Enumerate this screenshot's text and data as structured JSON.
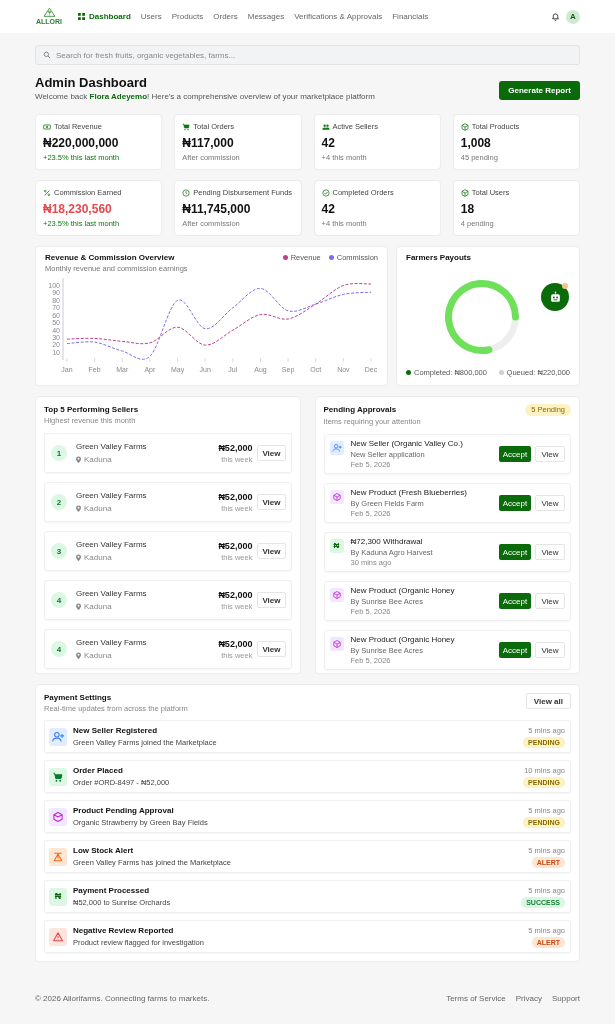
{
  "nav": {
    "logo_text": "ALLORI",
    "items": [
      {
        "label": "Dashboard",
        "selected": true,
        "has_icon": true
      },
      {
        "label": "Users",
        "selected": false,
        "has_icon": false
      },
      {
        "label": "Products",
        "selected": false,
        "has_icon": false
      },
      {
        "label": "Orders",
        "selected": false,
        "has_icon": false
      },
      {
        "label": "Messages",
        "selected": false,
        "has_icon": false
      },
      {
        "label": "Verifications & Approvals",
        "selected": false,
        "has_icon": false
      },
      {
        "label": "Financials",
        "selected": false,
        "has_icon": false
      }
    ],
    "avatar": "A"
  },
  "search": {
    "placeholder": "Search for fresh fruits, organic vegetables, farms..."
  },
  "header": {
    "title": "Admin Dashboard",
    "subtitle": "Welcome back **Flora Adeyemo**! Here's a comprehensive overview of your marketplace platform",
    "button": "Generate Report"
  },
  "stats": [
    {
      "kind": "cash",
      "label": "Total Revenue",
      "value": "₦220,000,000",
      "note": "+23.5% this last month",
      "trend_up": true,
      "color": "#111111"
    },
    {
      "kind": "cart",
      "label": "Total Orders",
      "value": "₦117,000",
      "note": "After commission",
      "trend_up": false,
      "color": "#111111"
    },
    {
      "kind": "users",
      "label": "Active Sellers",
      "value": "42",
      "note": "+4 this month",
      "trend_up": false,
      "color": "#111111"
    },
    {
      "kind": "cube",
      "label": "Total Products",
      "value": "1,008",
      "note": "45 pending",
      "trend_up": false,
      "color": "#111111"
    },
    {
      "kind": "percent",
      "label": "Commission Earned",
      "value": "₦18,230,560",
      "note": "+23.5% this last month",
      "trend_up": true,
      "color": "#e5484d"
    },
    {
      "kind": "clock",
      "label": "Pending Disbursement Funds",
      "value": "₦11,745,000",
      "note": "After commission",
      "trend_up": false,
      "color": "#111111"
    },
    {
      "kind": "check",
      "label": "Completed Orders",
      "value": "42",
      "note": "+4 this month",
      "trend_up": false,
      "color": "#111111"
    },
    {
      "kind": "cube",
      "label": "Total Users",
      "value": "18",
      "note": "4 pending",
      "trend_up": false,
      "color": "#111111"
    }
  ],
  "revenue_chart": {
    "subtitle": "Monthly revenue and commission earnings",
    "chart_data": {
      "type": "line",
      "title": "Revenue & Commission Overview",
      "categories": [
        "Jan",
        "Feb",
        "Mar",
        "Apr",
        "May",
        "Jun",
        "Jul",
        "Aug",
        "Sep",
        "Oct",
        "Nov",
        "Dec"
      ],
      "series": [
        {
          "name": "Revenue",
          "color": "#c0408f",
          "line_style": "dashed",
          "values": [
            28,
            29,
            25,
            23,
            44,
            20,
            40,
            61,
            55,
            75,
            100,
            102
          ]
        },
        {
          "name": "Commission",
          "color": "#7c6cf0",
          "line_style": "dashed",
          "values": [
            22,
            24,
            12,
            5,
            80,
            42,
            70,
            96,
            66,
            75,
            88,
            91
          ]
        }
      ],
      "ylim": [
        0,
        110
      ],
      "yticks": [
        10,
        20,
        30,
        40,
        50,
        60,
        70,
        80,
        90,
        100
      ]
    }
  },
  "payouts": {
    "title": "Farmers Payouts",
    "chart_data": {
      "type": "donut",
      "categories": [
        "Completed: ₦800,000",
        "Queued: ₦220,000"
      ],
      "values": [
        800000,
        220000
      ]
    },
    "legend": [
      {
        "color": "#0b6b0b"
      },
      {
        "color": "#cfcfcf"
      }
    ]
  },
  "top_sellers": {
    "title": "Top 5 Performing Sellers",
    "subtitle": "Highest revenue this month",
    "rows": [
      {
        "rank": "1",
        "name": "Green Valley Farms",
        "location": "Kaduna",
        "amount": "₦52,000",
        "period": "this week",
        "button": "View"
      },
      {
        "rank": "2",
        "name": "Green Valley Farms",
        "location": "Kaduna",
        "amount": "₦52,000",
        "period": "this week",
        "button": "View"
      },
      {
        "rank": "3",
        "name": "Green Valley Farms",
        "location": "Kaduna",
        "amount": "₦52,000",
        "period": "this week",
        "button": "View"
      },
      {
        "rank": "4",
        "name": "Green Valley Farms",
        "location": "Kaduna",
        "amount": "₦52,000",
        "period": "this week",
        "button": "View"
      },
      {
        "rank": "4",
        "name": "Green Valley Farms",
        "location": "Kaduna",
        "amount": "₦52,000",
        "period": "this week",
        "button": "View"
      }
    ]
  },
  "pending_approvals": {
    "title": "Pending Approvals",
    "badge": "5 Pending",
    "subtitle": "Items requiring your attention",
    "items": [
      {
        "kind": "seller",
        "title": "New Seller (Organic Valley Co.)",
        "by": "New Seller application",
        "date": "Feb 5, 2026",
        "accept": "Accept",
        "view": "View"
      },
      {
        "kind": "product",
        "title": "New Product (Fresh Blueberries)",
        "by": "By Green Fields Farm",
        "date": "Feb 5, 2026",
        "accept": "Accept",
        "view": "View"
      },
      {
        "kind": "withdrawal",
        "icon": "₦",
        "title": "₦72,300 Withdrawal",
        "by": "By Kaduna Agro Harvest",
        "date": "30 mins ago",
        "accept": "Accept",
        "view": "View"
      },
      {
        "kind": "product",
        "title": "New Product (Organic Honey",
        "by": "By Sunrise Bee Acres",
        "date": "Feb 5, 2026",
        "accept": "Accept",
        "view": "View"
      },
      {
        "kind": "product",
        "title": "New Product (Organic Honey",
        "by": "By Sunrise Bee Acres",
        "date": "Feb 5, 2026",
        "accept": "Accept",
        "view": "View"
      }
    ]
  },
  "payment_settings": {
    "title": "Payment Settings",
    "subtitle": "Real-time updates from across the platform",
    "button": "View all",
    "items": [
      {
        "kind": "seller",
        "title": "New Seller Registered",
        "description": "Green Valley Farms joined the Marketplace",
        "time": "5 mins ago",
        "status": {
          "label": "PENDING",
          "kind": "pending"
        }
      },
      {
        "kind": "order",
        "title": "Order Placed",
        "description": "Order #ORD-8497 - ₦52,000",
        "time": "10 mins ago",
        "status": {
          "label": "PENDING",
          "kind": "pending"
        }
      },
      {
        "kind": "product",
        "title": "Product Pending Approval",
        "description": "Organic Strawberry by Green Bay Fields",
        "time": "5 mins ago",
        "status": {
          "label": "PENDING",
          "kind": "pending"
        }
      },
      {
        "kind": "stock",
        "title": "Low Stock Alert",
        "description": "Green Valley Farms has joined the Marketplace",
        "time": "5 mins ago",
        "status": {
          "label": "ALERT",
          "kind": "alert"
        }
      },
      {
        "kind": "payment",
        "icon": "₦",
        "title": "Payment Processed",
        "description": "₦52,000 to Sunrise Orchards",
        "time": "5 mins ago",
        "status": {
          "label": "SUCCESS",
          "kind": "success"
        }
      },
      {
        "kind": "review",
        "title": "Negative Review Reported",
        "description": "Product review flagged for investigation",
        "time": "5 mins ago",
        "status": {
          "label": "ALERT",
          "kind": "alert"
        }
      }
    ]
  },
  "footer": {
    "copyright": "© 2026 Allorifarms. Connecting farms to markets.",
    "links": [
      "Terms of Service",
      "Privacy",
      "Support"
    ]
  }
}
